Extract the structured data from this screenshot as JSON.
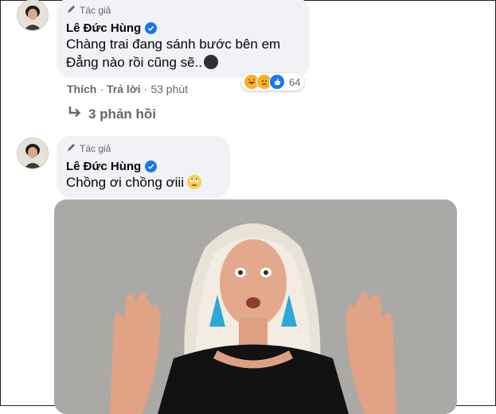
{
  "comments": [
    {
      "author_tag": "Tác giả",
      "author": "Lê Đức Hùng",
      "lines": [
        "Chàng trai đang sánh bước bên em",
        "Đẳng nào rồi cũng sẽ.."
      ],
      "actions": {
        "like": "Thích",
        "reply": "Trả lời",
        "sep": "·",
        "time": "53 phút"
      },
      "reactions": {
        "count": "64",
        "icons": [
          "haha-icon",
          "sad-icon",
          "like-icon"
        ]
      },
      "replies_label": "3 phản hồi"
    },
    {
      "author_tag": "Tác giả",
      "author": "Lê Đức Hùng",
      "lines": [
        "Chồng ơi chồng ơiii"
      ]
    }
  ],
  "colors": {
    "bubble": "#f0f2f5",
    "verified": "#1877f2",
    "secondary_text": "#65676b"
  }
}
